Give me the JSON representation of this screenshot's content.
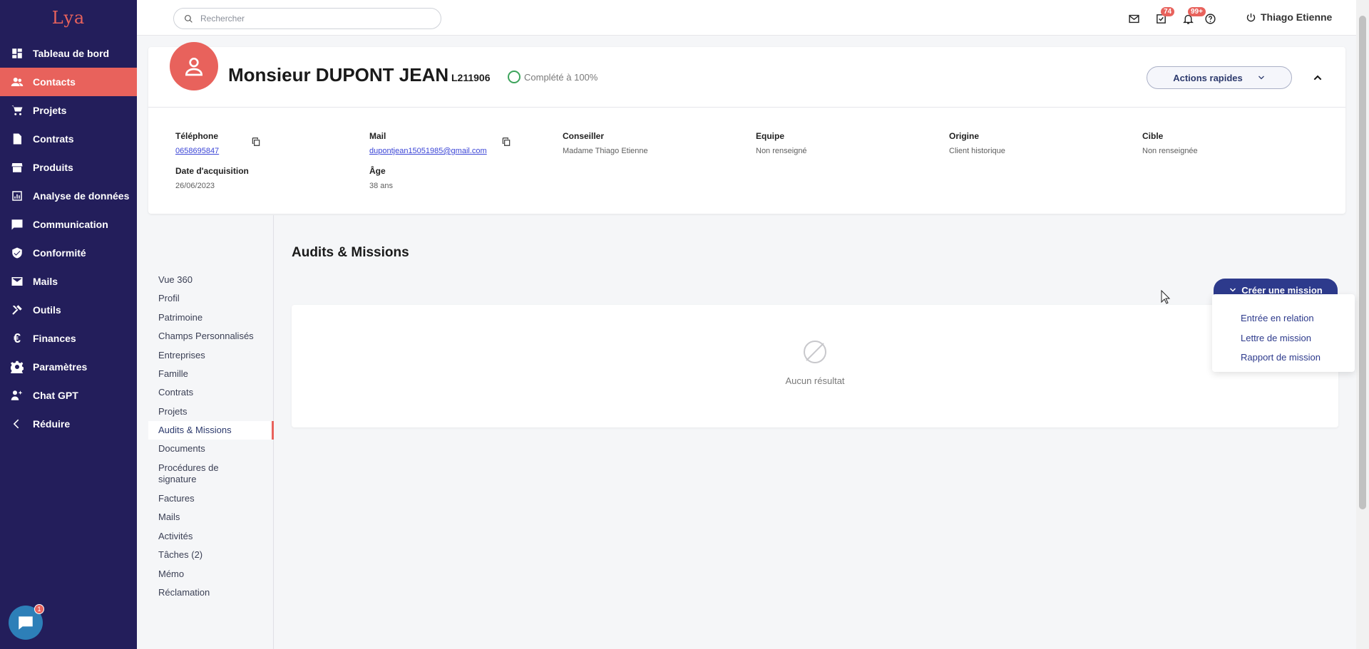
{
  "app": {
    "logo": "Lya"
  },
  "sidebar": {
    "items": [
      {
        "label": "Tableau de bord",
        "icon": "dashboard-icon"
      },
      {
        "label": "Contacts",
        "icon": "users-icon",
        "active": true
      },
      {
        "label": "Projets",
        "icon": "cart-icon"
      },
      {
        "label": "Contrats",
        "icon": "document-icon"
      },
      {
        "label": "Produits",
        "icon": "store-icon"
      },
      {
        "label": "Analyse de données",
        "icon": "analytics-icon"
      },
      {
        "label": "Communication",
        "icon": "message-icon"
      },
      {
        "label": "Conformité",
        "icon": "shield-check-icon"
      },
      {
        "label": "Mails",
        "icon": "mail-icon"
      },
      {
        "label": "Outils",
        "icon": "tools-icon"
      },
      {
        "label": "Finances",
        "icon": "euro-icon"
      },
      {
        "label": "Paramètres",
        "icon": "gear-icon"
      },
      {
        "label": "Chat GPT",
        "icon": "ai-icon"
      },
      {
        "label": "Réduire",
        "icon": "chevron-left-icon"
      }
    ],
    "chat_badge": "1"
  },
  "topbar": {
    "search_placeholder": "Rechercher",
    "tasks_badge": "74",
    "notifications_badge": "99+",
    "user_name": "Thiago Etienne"
  },
  "contact": {
    "name": "Monsieur DUPONT JEAN",
    "reference": "L211906",
    "completion": "Complété à 100%",
    "quick_actions": "Actions rapides",
    "fields": {
      "phone_label": "Téléphone",
      "phone": "0658695847",
      "mail_label": "Mail",
      "mail": "dupontjean15051985@gmail.com",
      "advisor_label": "Conseiller",
      "advisor": "Madame Thiago Etienne",
      "team_label": "Equipe",
      "team": "Non renseigné",
      "origin_label": "Origine",
      "origin": "Client historique",
      "target_label": "Cible",
      "target": "Non renseignée",
      "acquisition_label": "Date d'acquisition",
      "acquisition": "26/06/2023",
      "age_label": "Âge",
      "age": "38 ans"
    }
  },
  "subnav": {
    "items": [
      "Vue 360",
      "Profil",
      "Patrimoine",
      "Champs Personnalisés",
      "Entreprises",
      "Famille",
      "Contrats",
      "Projets",
      "Audits & Missions",
      "Documents",
      "Procédures de signature",
      "Factures",
      "Mails",
      "Activités",
      "Tâches (2)",
      "Mémo",
      "Réclamation"
    ],
    "active_index": 8
  },
  "main": {
    "title": "Audits & Missions",
    "create_button": "Créer une mission",
    "empty_text": "Aucun résultat",
    "dropdown": [
      "Entrée en relation",
      "Lettre de mission",
      "Rapport de mission"
    ]
  },
  "colors": {
    "sidebar_bg": "#231e5b",
    "accent": "#e8625c",
    "primary": "#2d3a8c"
  }
}
